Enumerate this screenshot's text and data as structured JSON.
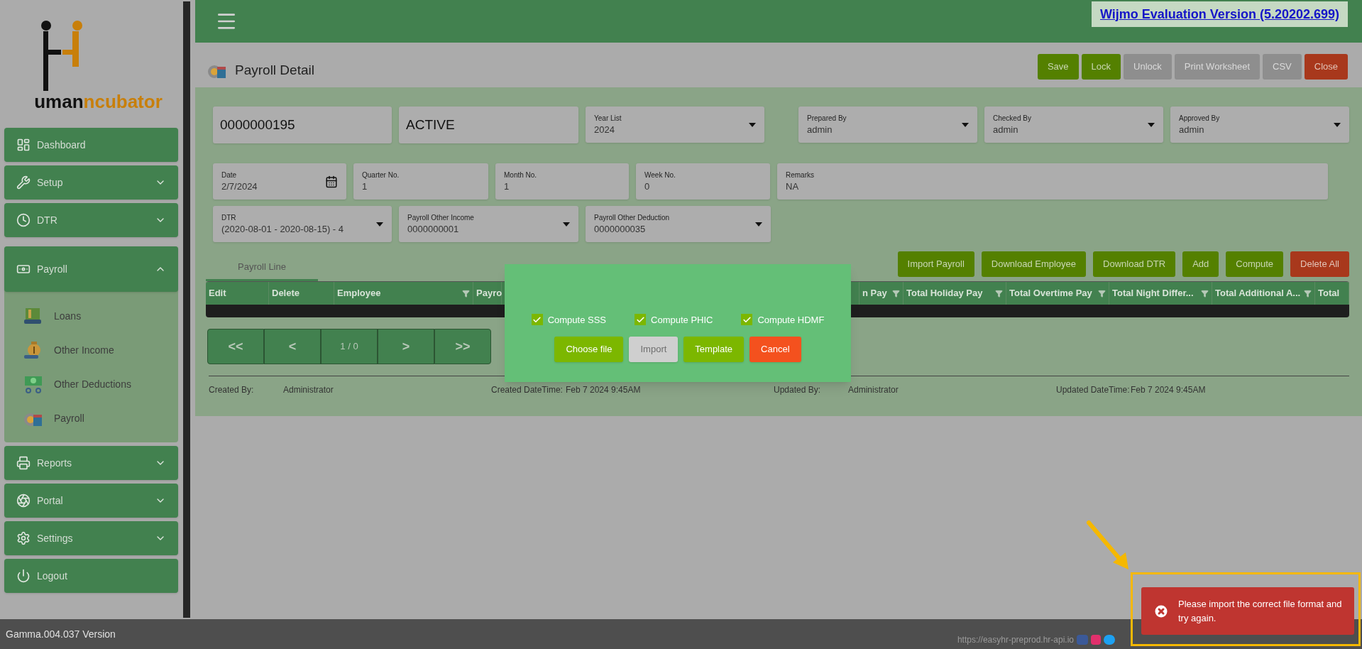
{
  "logo": {
    "dark": "uman",
    "accent": "ncubator"
  },
  "sidebar": {
    "items": [
      {
        "label": "Dashboard"
      },
      {
        "label": "Setup",
        "expanded": false
      },
      {
        "label": "DTR",
        "expanded": false
      },
      {
        "label": "Payroll",
        "expanded": true,
        "children": [
          {
            "label": "Loans"
          },
          {
            "label": "Other Income"
          },
          {
            "label": "Other Deductions"
          },
          {
            "label": "Payroll"
          }
        ]
      },
      {
        "label": "Reports",
        "expanded": false
      },
      {
        "label": "Portal",
        "expanded": false
      },
      {
        "label": "Settings",
        "expanded": false
      },
      {
        "label": "Logout"
      }
    ]
  },
  "version": "Gamma.004.037 Version",
  "header": {
    "banner": "Wijmo Evaluation Version (5.20202.699)"
  },
  "page": {
    "title": "Payroll Detail"
  },
  "toolbar": [
    {
      "label": "Save",
      "kind": "primary",
      "disabled": false
    },
    {
      "label": "Lock",
      "kind": "primary",
      "disabled": false
    },
    {
      "label": "Unlock",
      "kind": "primary",
      "disabled": true
    },
    {
      "label": "Print Worksheet",
      "kind": "primary",
      "disabled": true
    },
    {
      "label": "CSV",
      "kind": "primary",
      "disabled": true
    },
    {
      "label": "Close",
      "kind": "danger",
      "disabled": false
    }
  ],
  "form": {
    "rows": [
      [
        {
          "kind": "big",
          "value": "0000000195"
        },
        {
          "kind": "big",
          "value": "ACTIVE"
        },
        {
          "kind": "select",
          "label": "Year List",
          "value": "2024"
        },
        {
          "kind": "gap"
        },
        {
          "kind": "select",
          "label": "Prepared By",
          "value": "admin"
        },
        {
          "kind": "select",
          "label": "Checked By",
          "value": "admin"
        },
        {
          "kind": "select",
          "label": "Approved By",
          "value": "admin"
        }
      ],
      [
        {
          "kind": "date",
          "label": "Date",
          "value": "2/7/2024"
        },
        {
          "kind": "input",
          "label": "Quarter No.",
          "value": "1"
        },
        {
          "kind": "input",
          "label": "Month No.",
          "value": "1"
        },
        {
          "kind": "input",
          "label": "Week No.",
          "value": "0"
        },
        {
          "kind": "wide",
          "label": "Remarks",
          "value": "NA"
        }
      ],
      [
        {
          "kind": "select",
          "label": "DTR",
          "value": "(2020-08-01 - 2020-08-15) - 4"
        },
        {
          "kind": "select",
          "label": "Payroll Other Income",
          "value": "0000000001"
        },
        {
          "kind": "select",
          "label": "Payroll Other Deduction",
          "value": "0000000035"
        }
      ]
    ]
  },
  "tabs": [
    {
      "label": "Payroll Line",
      "selected": true
    }
  ],
  "actions": [
    {
      "label": "Import Payroll",
      "kind": "primary"
    },
    {
      "label": "Download Employee",
      "kind": "primary"
    },
    {
      "label": "Download DTR",
      "kind": "primary"
    },
    {
      "label": "Add",
      "kind": "primary"
    },
    {
      "label": "Compute",
      "kind": "primary"
    },
    {
      "label": "Delete All",
      "kind": "danger"
    }
  ],
  "table": {
    "columns": [
      {
        "label": "Edit",
        "filter": false
      },
      {
        "label": "Delete",
        "filter": false
      },
      {
        "label": "Employee",
        "filter": true
      },
      {
        "label": "Payro"
      },
      {
        "label": "n Pay",
        "filter": true
      },
      {
        "label": "Total Holiday Pay",
        "filter": true
      },
      {
        "label": "Total Overtime Pay",
        "filter": true
      },
      {
        "label": "Total Night Differ...",
        "filter": true
      },
      {
        "label": "Total Additional A...",
        "filter": true
      },
      {
        "label": "Total"
      }
    ]
  },
  "pager": {
    "first": "<<",
    "prev": "<",
    "page": "1 / 0",
    "next": ">",
    "last": ">>"
  },
  "audit": [
    {
      "label": "Created By:",
      "value": "Administrator"
    },
    {
      "label": "Created DateTime:",
      "value": "Feb 7 2024 9:45AM"
    },
    {
      "label": "Updated By:",
      "value": "Administrator"
    },
    {
      "label": "Updated DateTime:",
      "value": "Feb 7 2024 9:45AM"
    }
  ],
  "modal": {
    "checkboxes": [
      {
        "label": "Compute SSS",
        "checked": true
      },
      {
        "label": "Compute PHIC",
        "checked": true
      },
      {
        "label": "Compute HDMF",
        "checked": true
      }
    ],
    "buttons": [
      {
        "label": "Choose file",
        "kind": "primary",
        "disabled": false
      },
      {
        "label": "Import",
        "kind": "primary",
        "disabled": true
      },
      {
        "label": "Template",
        "kind": "primary",
        "disabled": false
      },
      {
        "label": "Cancel",
        "kind": "danger",
        "disabled": false
      }
    ]
  },
  "toast": {
    "kind": "error",
    "message": "Please import the correct file format and try again."
  },
  "footer": {
    "url": "https://easyhr-preprod.hr-api.io"
  }
}
